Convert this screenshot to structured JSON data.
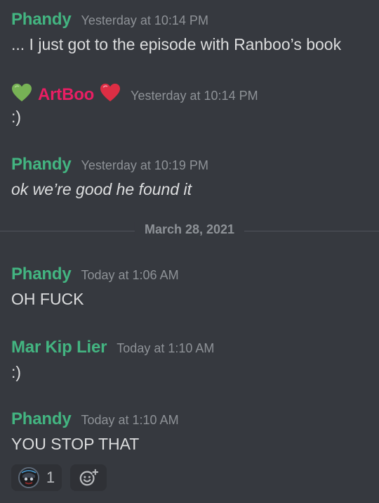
{
  "messages": [
    {
      "author": "Phandy",
      "author_color": "#43b581",
      "timestamp": "Yesterday at 10:14 PM",
      "text": "... I just got to the episode with Ranboo’s book"
    },
    {
      "author": "ArtBoo",
      "author_color": "#e91e63",
      "timestamp": "Yesterday at 10:14 PM",
      "text": ":)",
      "left_icon": "green-heart-icon",
      "right_icon": "red-heart-icon"
    },
    {
      "author": "Phandy",
      "author_color": "#43b581",
      "timestamp": "Yesterday at 10:19 PM",
      "text": "ok we’re good he found it"
    },
    {
      "author": "Phandy",
      "author_color": "#43b581",
      "timestamp": "Today at 1:06 AM",
      "text": "OH FUCK"
    },
    {
      "author": "Mar Kip Lier",
      "author_color": "#43b581",
      "timestamp": "Today at 1:10 AM",
      "text": ":)"
    },
    {
      "author": "Phandy",
      "author_color": "#43b581",
      "timestamp": "Today at 1:10 AM",
      "text": "YOU STOP THAT"
    }
  ],
  "date_divider": "March 28, 2021",
  "reaction": {
    "icon": "custom-emoji-icon",
    "count": "1"
  },
  "add_reaction_icon": "add-reaction-icon"
}
